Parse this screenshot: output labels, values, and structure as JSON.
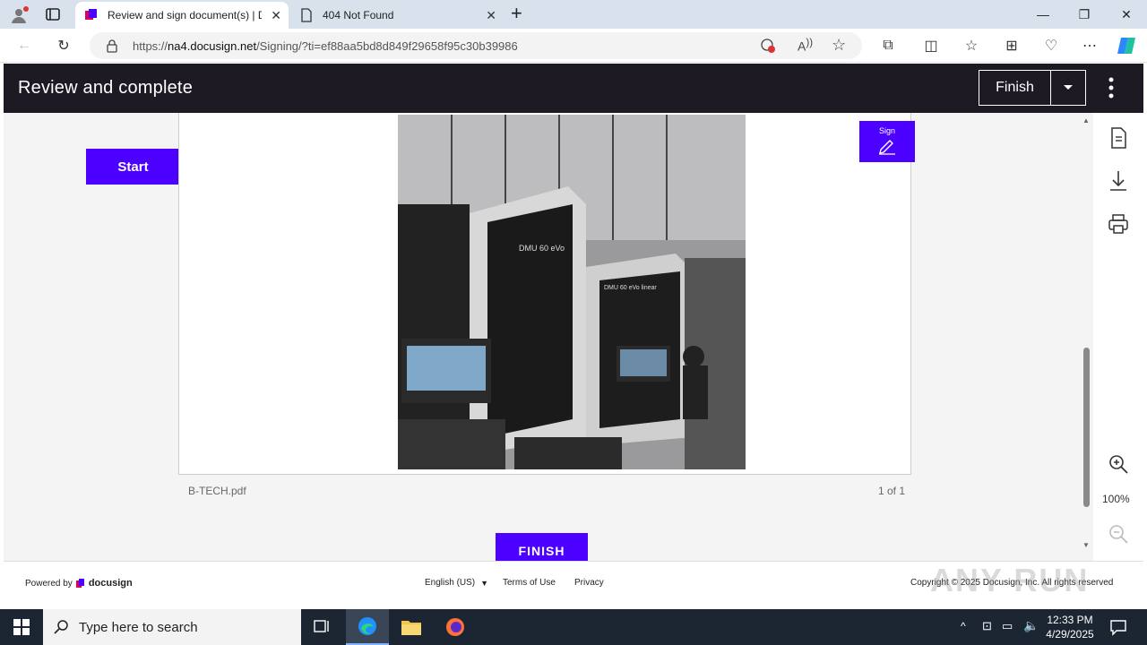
{
  "browser": {
    "tabs": [
      {
        "title": "Review and sign document(s) | D",
        "active": true
      },
      {
        "title": "404 Not Found",
        "active": false
      }
    ],
    "url_prefix": "https://",
    "url_domain": "na4.docusign.net",
    "url_path": "/Signing/?ti=ef88aa5bd8d849f29658f95c30b39986"
  },
  "header": {
    "title": "Review and complete",
    "finish_label": "Finish"
  },
  "document": {
    "start_label": "Start",
    "sign_label": "Sign",
    "filename": "B-TECH.pdf",
    "page_count": "1 of 1",
    "finish_label": "FINISH",
    "photo_text_1": "DMU 60 eVo",
    "photo_text_2": "DMU 60 eVo linear"
  },
  "rail": {
    "zoom": "100%"
  },
  "footer": {
    "powered_by": "Powered by",
    "brand": "docusign",
    "language": "English (US)",
    "terms": "Terms of Use",
    "privacy": "Privacy",
    "copyright": "Copyright © 2025 Docusign, Inc. All rights reserved",
    "watermark": "ANY RUN"
  },
  "taskbar": {
    "search_placeholder": "Type here to search",
    "time": "12:33 PM",
    "date": "4/29/2025"
  },
  "colors": {
    "accent": "#4c00ff",
    "header_bg": "#1e1a24",
    "taskbar_bg": "#1c2633"
  }
}
